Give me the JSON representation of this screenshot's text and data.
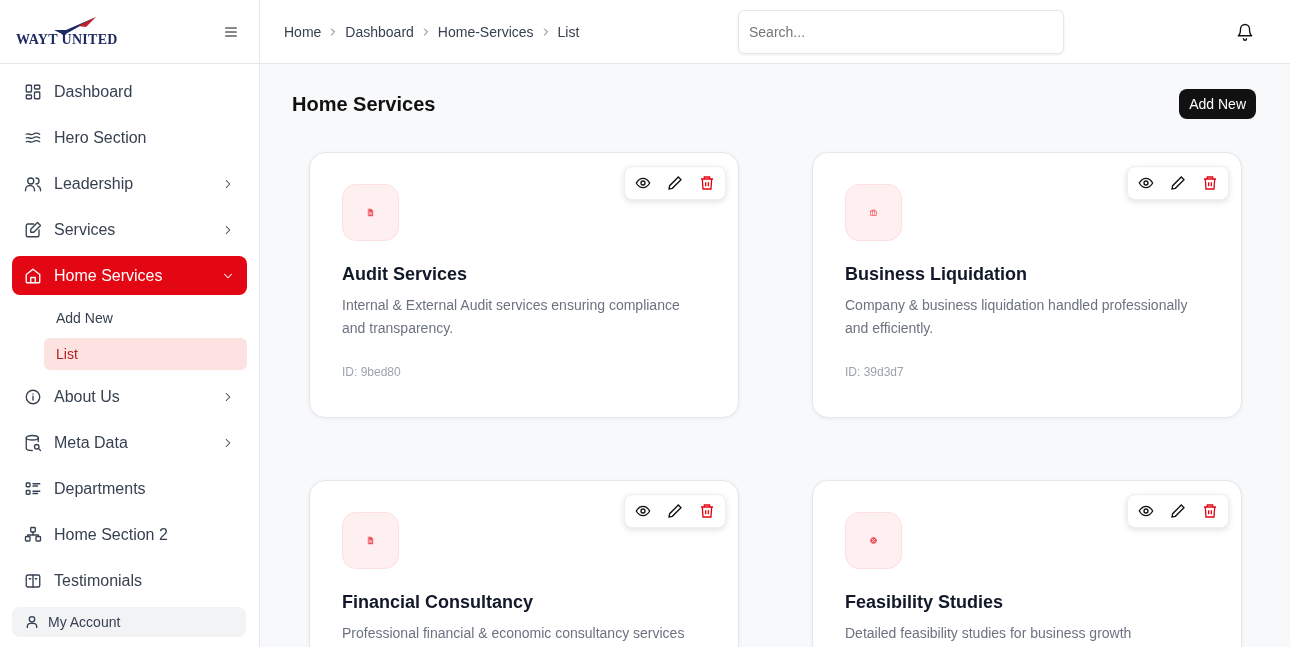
{
  "logo": {
    "text": "WAYT UNITED"
  },
  "sidebar": {
    "items": [
      {
        "label": "Dashboard",
        "selected": false
      },
      {
        "label": "Hero Section",
        "selected": false
      },
      {
        "label": "Leadership",
        "expanded": false,
        "selected": false
      },
      {
        "label": "Services",
        "expanded": false,
        "selected": false
      },
      {
        "label": "Home Services",
        "expanded": true,
        "selected": true,
        "children": [
          {
            "label": "Add New",
            "selected": false
          },
          {
            "label": "List",
            "selected": true
          }
        ]
      },
      {
        "label": "About Us",
        "expanded": false,
        "selected": false
      },
      {
        "label": "Meta Data",
        "expanded": false,
        "selected": false
      },
      {
        "label": "Departments",
        "selected": false
      },
      {
        "label": "Home Section 2",
        "selected": false
      },
      {
        "label": "Testimonials",
        "selected": false
      }
    ],
    "account": "My Account"
  },
  "breadcrumb": [
    "Home",
    "Dashboard",
    "Home-Services",
    "List"
  ],
  "search": {
    "placeholder": "Search..."
  },
  "page": {
    "title": "Home Services",
    "add_button": "Add New"
  },
  "cards": [
    {
      "title": "Audit Services",
      "description": "Internal & External Audit services ensuring compliance and transparency.",
      "id": "ID: 9bed80"
    },
    {
      "title": "Business Liquidation",
      "description": "Company & business liquidation handled professionally and efficiently.",
      "id": "ID: 39d3d7"
    },
    {
      "title": "Financial Consultancy",
      "description": "Professional financial & economic consultancy services"
    },
    {
      "title": "Feasibility Studies",
      "description": "Detailed feasibility studies for business growth"
    }
  ]
}
